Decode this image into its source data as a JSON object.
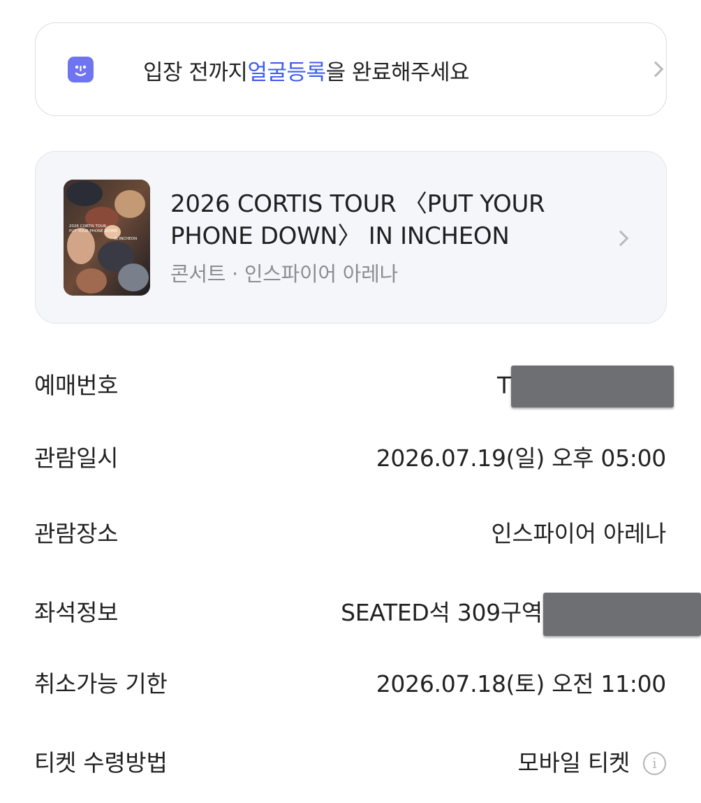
{
  "face_banner": {
    "prefix": "입장 전까지 ",
    "highlight": "얼굴등록",
    "suffix": "을 완료해주세요",
    "icon": "face-id-icon",
    "accent_color": "#3d5cf0",
    "icon_color": "#6f74f0"
  },
  "event": {
    "title": "2026 CORTIS TOUR 〈PUT YOUR PHONE DOWN〉 IN INCHEON",
    "subtitle": "콘서트 · 인스파이어 아레나",
    "poster_text": {
      "line1": "2026 CORTIS TOUR",
      "line2": "PUT YOUR PHONE DOWN",
      "line3": "IN INCHEON"
    }
  },
  "details": {
    "booking_number": {
      "label": "예매번호",
      "value": "T"
    },
    "date": {
      "label": "관람일시",
      "value": "2026.07.19(일) 오후 05:00"
    },
    "venue": {
      "label": "관람장소",
      "value": "인스파이어 아레나"
    },
    "seat": {
      "label": "좌석정보",
      "value": "SEATED석 309구역"
    },
    "cancel_deadline": {
      "label": "취소가능 기한",
      "value": "2026.07.18(토) 오전 11:00"
    },
    "ticket_method": {
      "label": "티켓 수령방법",
      "value": "모바일 티켓",
      "icon": "info-icon"
    }
  }
}
